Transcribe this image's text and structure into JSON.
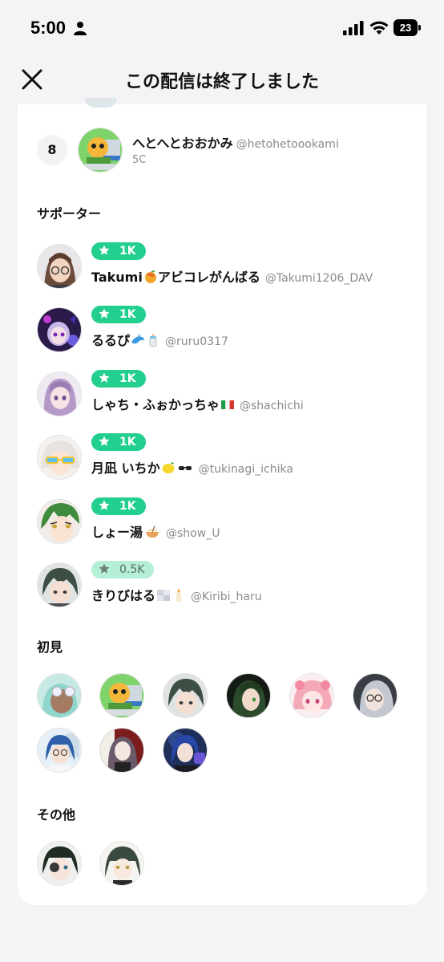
{
  "status_bar": {
    "time": "5:00",
    "battery": "23"
  },
  "header": {
    "title": "この配信は終了しました"
  },
  "ranking": {
    "rank": "8",
    "name": "へとへとおおかみ",
    "handle": "@hetohetoookami",
    "sub": "5C"
  },
  "sections": {
    "supporters": "サポーター",
    "first_time": "初見",
    "others": "その他"
  },
  "supporters": [
    {
      "badge": "1K",
      "name": "Takumi",
      "name_after": "アビコレがんばる",
      "handle": "@Takumi1206_DAV"
    },
    {
      "badge": "1K",
      "name": "るるぴ",
      "handle": "@ruru0317"
    },
    {
      "badge": "1K",
      "name": "しゃち・ふぉかっちゃ",
      "handle": "@shachichi"
    },
    {
      "badge": "1K",
      "name": "月凪 いちか",
      "handle": "@tukinagi_ichika"
    },
    {
      "badge": "1K",
      "name": "しょー湯",
      "handle": "@show_U"
    },
    {
      "badge": "0.5K",
      "name": "きりびはる",
      "handle": "@Kiribi_haru"
    }
  ],
  "colors": {
    "accent": "#22cf8e",
    "accent_light": "#b5efd6"
  }
}
